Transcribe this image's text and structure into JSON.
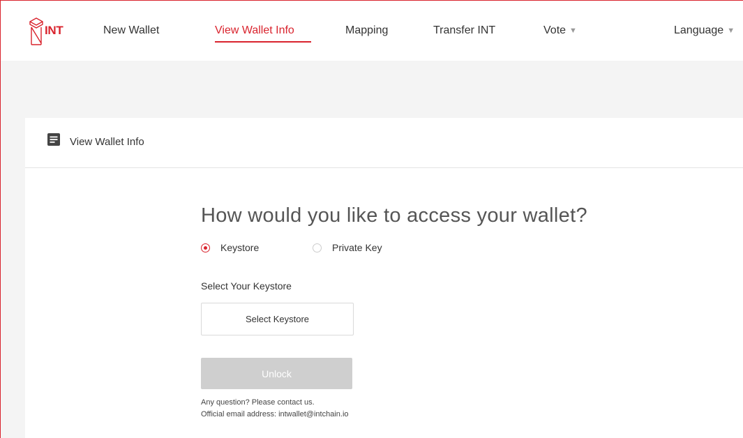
{
  "brand": {
    "name": "INT",
    "color": "#d9232d"
  },
  "nav": {
    "items": [
      {
        "label": "New Wallet"
      },
      {
        "label": "View Wallet Info",
        "active": true
      },
      {
        "label": "Mapping"
      },
      {
        "label": "Transfer INT"
      },
      {
        "label": "Vote",
        "dropdown": true
      },
      {
        "label": "Language",
        "dropdown": true
      }
    ],
    "caret": "▼"
  },
  "card": {
    "icon": "document-icon",
    "title": "View Wallet Info"
  },
  "access": {
    "question": "How would you like to access your wallet?",
    "options": [
      {
        "label": "Keystore",
        "checked": true
      },
      {
        "label": "Private Key",
        "checked": false
      }
    ],
    "select_label": "Select Your Keystore",
    "select_button": "Select Keystore",
    "unlock_button": "Unlock",
    "contact_line1": "Any question? Please contact us.",
    "contact_line2": "Official email address: intwallet@intchain.io"
  },
  "colors": {
    "accent": "#d9232d",
    "disabled_button": "#cfcfcf",
    "page_background": "#f4f4f4"
  }
}
